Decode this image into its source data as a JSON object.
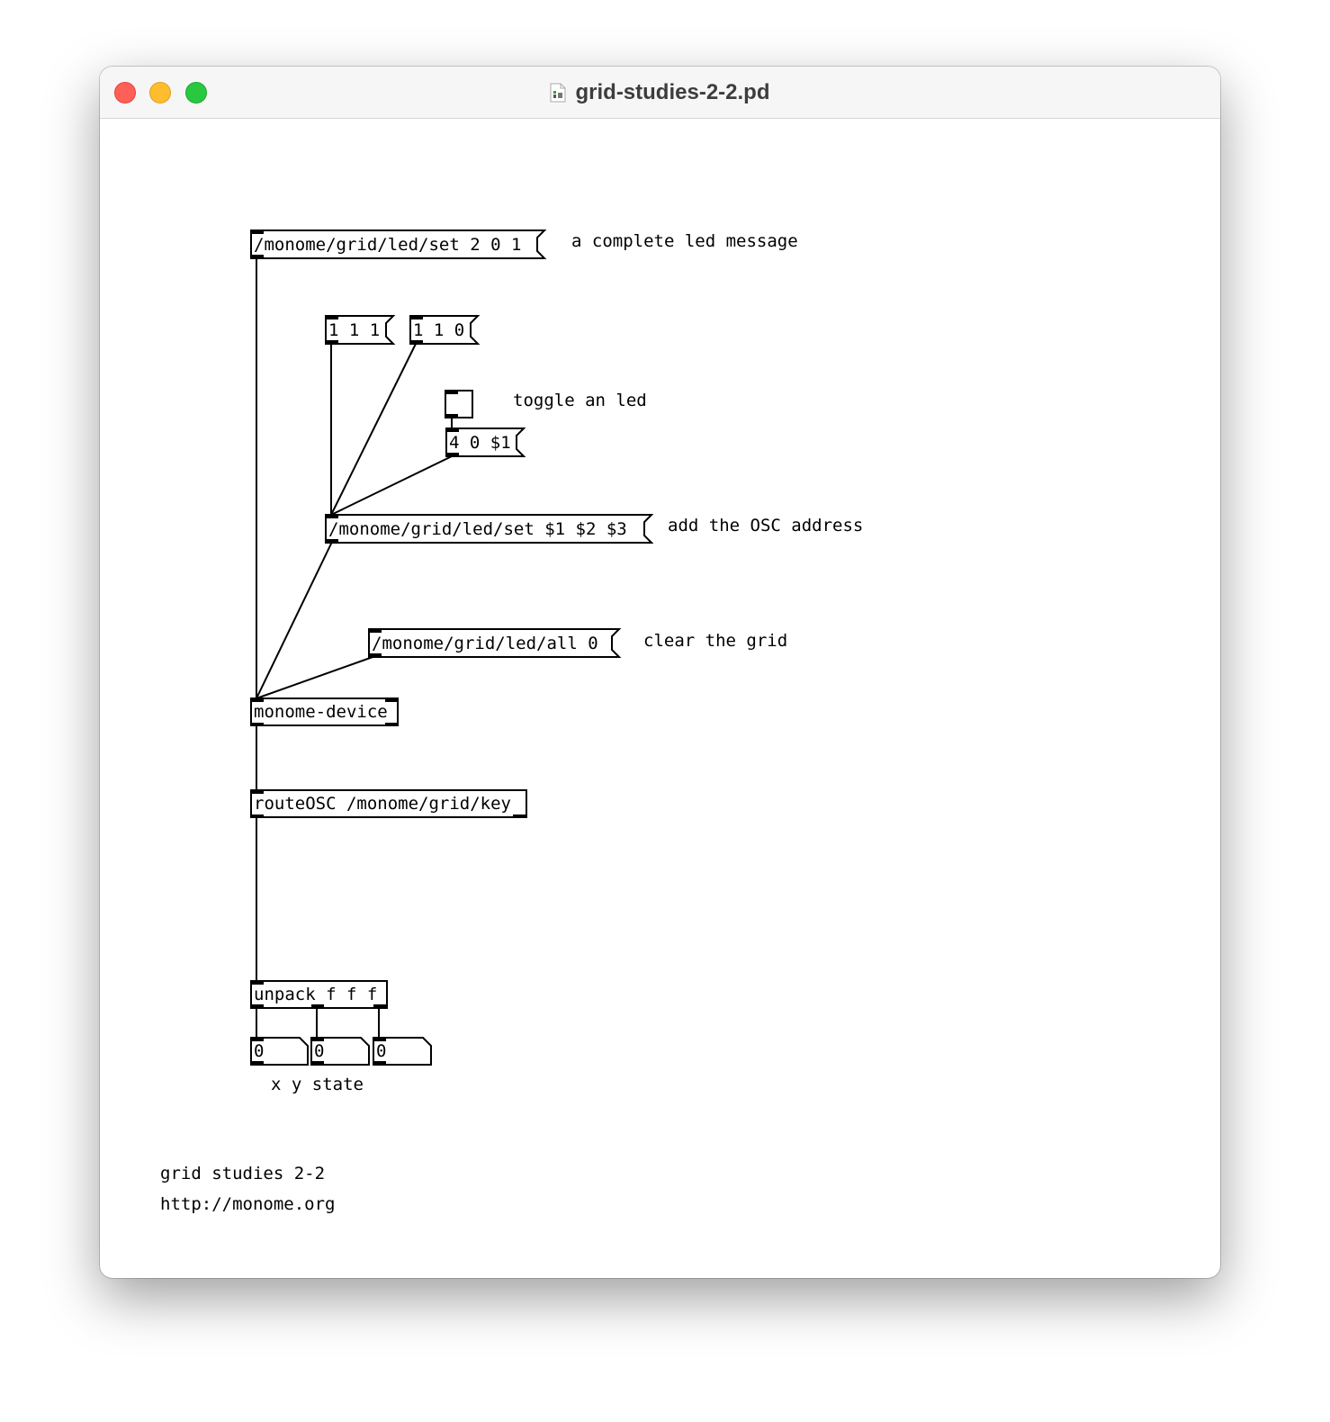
{
  "window": {
    "title": "grid-studies-2-2.pd"
  },
  "patch": {
    "msg_complete": "/monome/grid/led/set 2 0 1",
    "comment_complete": "a complete led message",
    "msg_111": "1 1 1",
    "msg_110": "1 1 0",
    "comment_toggle": "toggle an led",
    "msg_40": "4 0 $1",
    "msg_set_args": "/monome/grid/led/set $1 $2 $3",
    "comment_osc": "add the OSC address",
    "msg_all": "/monome/grid/led/all 0",
    "comment_clear": "clear the grid",
    "obj_device": "monome-device",
    "obj_route": "routeOSC /monome/grid/key",
    "obj_unpack": "unpack f f f",
    "num_x": "0",
    "num_y": "0",
    "num_state": "0",
    "comment_xy": "x y state",
    "comment_title": "grid studies 2-2",
    "comment_url": "http://monome.org"
  }
}
